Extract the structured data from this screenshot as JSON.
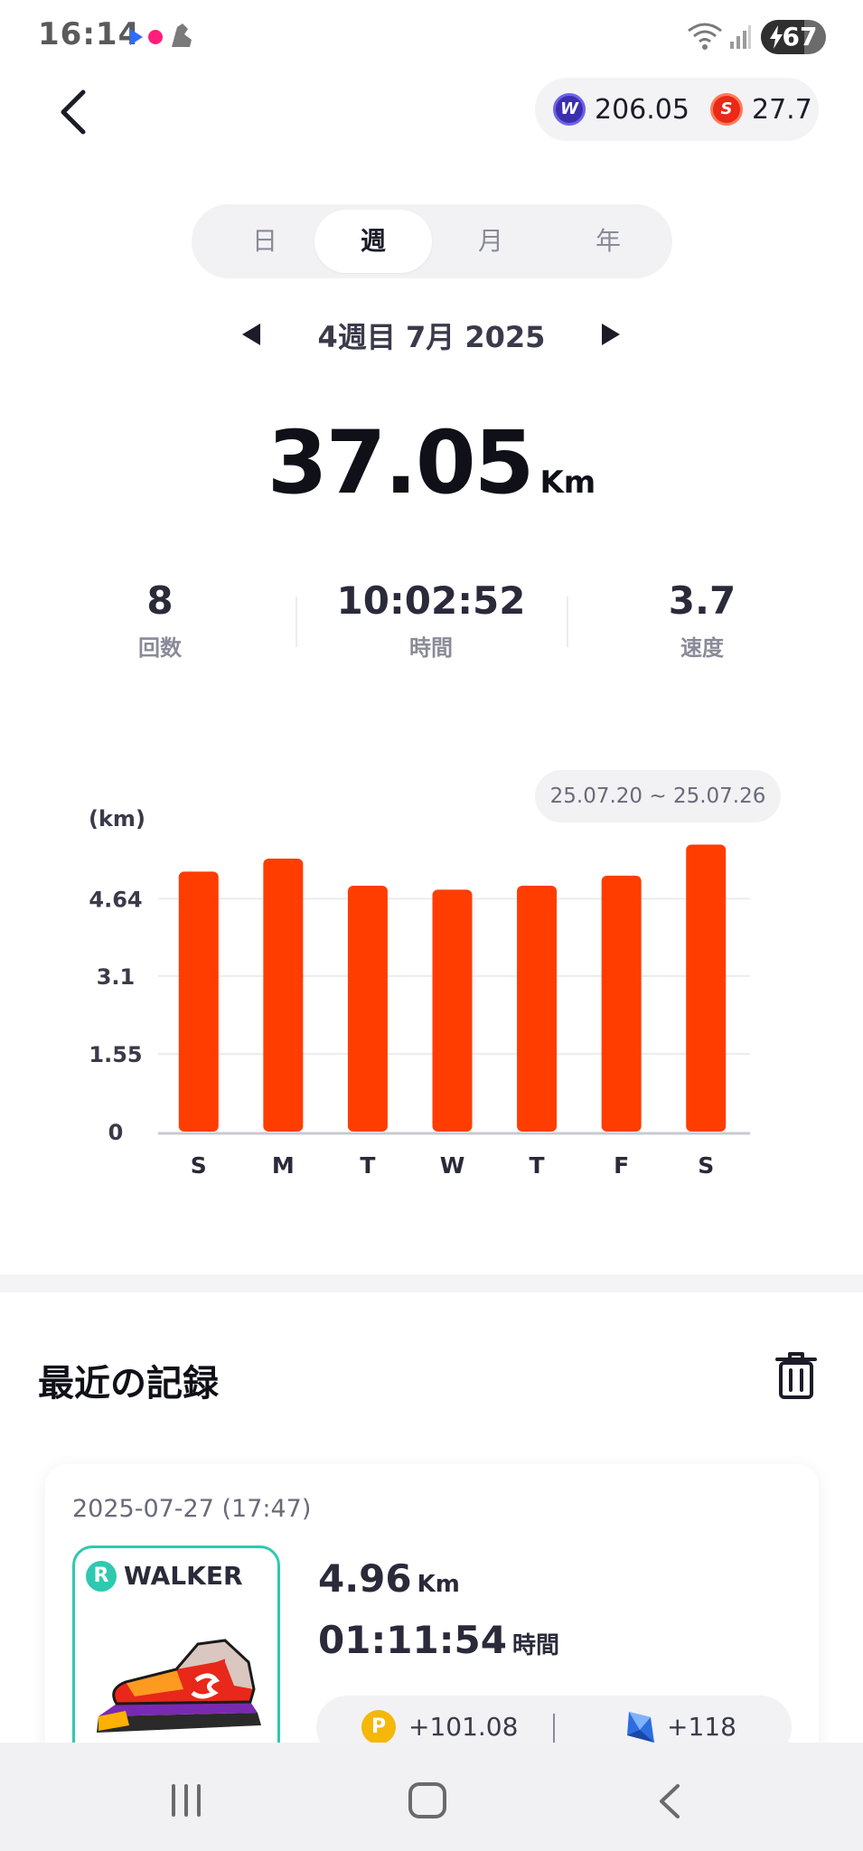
{
  "status_bar": {
    "time": "16:14",
    "battery": "67"
  },
  "header": {
    "back_label": "<",
    "balance_w": "206.05",
    "balance_s": "27.7",
    "coin_w_letter": "W",
    "coin_s_letter": "S"
  },
  "tabs": [
    {
      "label": "日",
      "active": false
    },
    {
      "label": "週",
      "active": true
    },
    {
      "label": "月",
      "active": false
    },
    {
      "label": "年",
      "active": false
    }
  ],
  "week_label": "4週目 7月 2025",
  "summary": {
    "distance": "37.05",
    "unit": "Km",
    "stats": [
      {
        "value": "8",
        "label": "回数"
      },
      {
        "value": "10:02:52",
        "label": "時間"
      },
      {
        "value": "3.7",
        "label": "速度"
      }
    ]
  },
  "chart_data": {
    "type": "bar",
    "unit_label": "(km)",
    "range": "25.07.20 ~ 25.07.26",
    "categories": [
      "S",
      "M",
      "T",
      "W",
      "T",
      "F",
      "S"
    ],
    "values": [
      5.18,
      5.44,
      4.9,
      4.82,
      4.9,
      5.1,
      5.72
    ],
    "yticks": [
      {
        "value": 0,
        "label": "0"
      },
      {
        "value": 1.55,
        "label": "1.55"
      },
      {
        "value": 3.1,
        "label": "3.1"
      },
      {
        "value": 4.64,
        "label": "4.64"
      }
    ],
    "ylim": [
      0,
      5.8
    ],
    "bar_color": "#ff3d00"
  },
  "recent": {
    "title": "最近の記録",
    "card": {
      "date": "2025-07-27 (17:47)",
      "shoe_badge": "R",
      "shoe_type": "WALKER",
      "distance": "4.96",
      "distance_unit": "Km",
      "time": "01:11:54",
      "time_unit": "時間",
      "reward_p_letter": "P",
      "reward_p": "+101.08",
      "reward_gem": "+118"
    }
  }
}
